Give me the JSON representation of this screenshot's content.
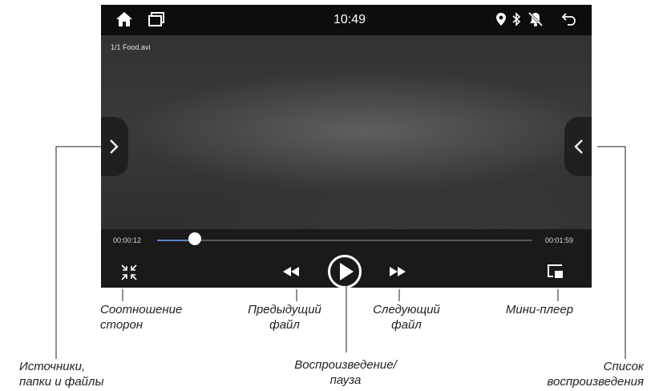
{
  "status_bar": {
    "clock": "10:49",
    "icons": [
      "home-icon",
      "recent-apps-icon",
      "location-icon",
      "bluetooth-icon",
      "notifications-off-icon",
      "back-icon"
    ]
  },
  "player": {
    "file_label": "1/1   Food.avi",
    "elapsed": "00:00:12",
    "duration": "00:01:59",
    "progress_fraction": 0.1
  },
  "controls": {
    "icons": [
      "aspect-ratio-icon",
      "previous-icon",
      "play-icon",
      "next-icon",
      "mini-player-icon"
    ]
  },
  "side_buttons": {
    "left_icon": "chevron-right-icon",
    "right_icon": "chevron-left-icon"
  },
  "callouts": {
    "aspect_ratio": [
      "Соотношение",
      "сторон"
    ],
    "previous_file": [
      "Предыдущий",
      "файл"
    ],
    "next_file": [
      "Следующий",
      "файл"
    ],
    "mini_player": "Мини-плеер",
    "sources": [
      "Источники,",
      "папки и файлы"
    ],
    "play_pause": [
      "Воспроизведение/",
      "пауза"
    ],
    "playlist": [
      "Список",
      "воспроизведения"
    ]
  },
  "colors": {
    "accent": "#5b87c9",
    "status_bar": "#0d0d0d",
    "controls_bg": "#1a1a1a"
  }
}
